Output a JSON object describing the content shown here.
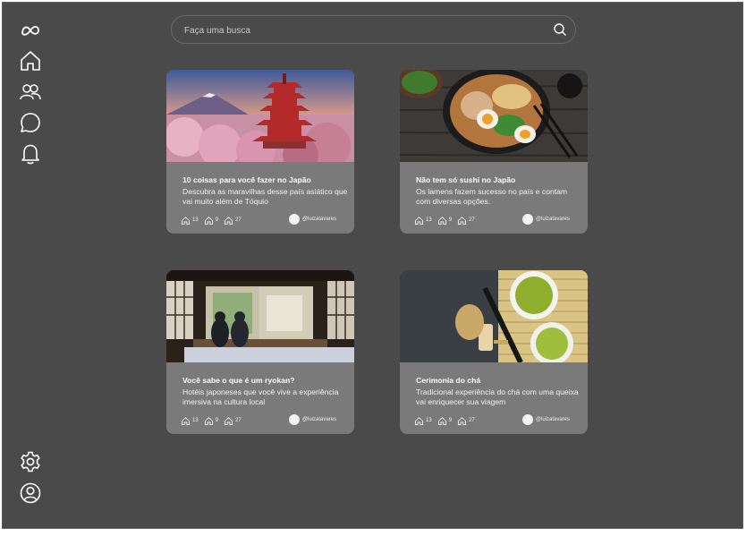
{
  "search": {
    "placeholder": "Faça uma busca"
  },
  "sidebar": {
    "items": [
      {
        "icon": "meta-logo-icon"
      },
      {
        "icon": "home-icon"
      },
      {
        "icon": "users-icon"
      },
      {
        "icon": "chat-bubble-icon"
      },
      {
        "icon": "bell-icon"
      },
      {
        "icon": "gear-icon"
      },
      {
        "icon": "user-circle-icon"
      }
    ]
  },
  "cards": [
    {
      "title": "10 coisas para você fazer no Japão",
      "description": "Descubra as maravilhas desse país asiático que vai muito além de Tóquio",
      "image": "pagoda-mount-fuji-cherry-blossoms",
      "stats": [
        "13",
        "9",
        "27"
      ],
      "author": "@luizatavares"
    },
    {
      "title": "Não tem só sushi no Japão",
      "description": "Os lamens fazem sucesso no país e contam com diversas opções.",
      "image": "ramen-bowl",
      "stats": [
        "13",
        "9",
        "27"
      ],
      "author": "@luizatavares"
    },
    {
      "title": "Você sabe o que é um ryokan?",
      "description": "Hotéis japoneses que você vive a experiência imersiva na cultura local",
      "image": "ryokan-room",
      "stats": [
        "13",
        "9",
        "27"
      ],
      "author": "@luizatavares"
    },
    {
      "title": "Cerimonia do chá",
      "description": "Tradicional experiência do chá com uma queixa vai enriquecer sua viagem",
      "image": "matcha-tea-ceremony",
      "stats": [
        "13",
        "9",
        "27"
      ],
      "author": "@luizatavares"
    }
  ],
  "colors": {
    "background": "#4a4a4a",
    "card": "#7a7a7a",
    "text": "#ffffff"
  }
}
